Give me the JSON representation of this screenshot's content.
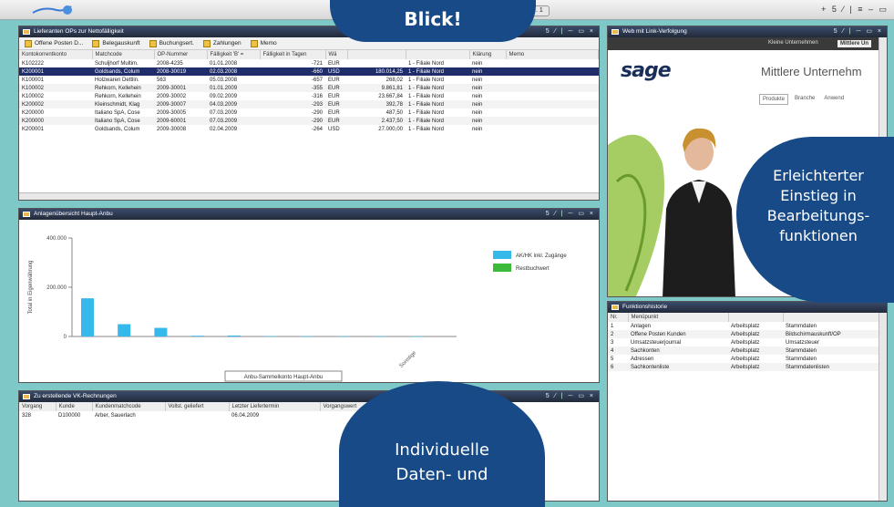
{
  "topbar": {
    "tab_label": "Liefer... 1",
    "icons": "+ 5 ⁄ | ≡ – ▭"
  },
  "payables": {
    "title": "Lieferanten OPs zur Nettofälligkeit",
    "toolbar": [
      "Offene Posten D...",
      "Belegauskunft",
      "Buchungsert.",
      "Zahlungen",
      "Memo"
    ],
    "columns": [
      "Kontokorrentkonto",
      "Matchcode",
      "OP-Nummer",
      "Fälligkeit 'B' =",
      "Fälligkeit in Tagen",
      "Wä",
      "",
      "",
      "Klärung",
      "Memo"
    ],
    "rows": [
      [
        "K102222",
        "Schuljhorf Multim.",
        "2008-4235",
        "01.01.2008",
        "-721",
        "EUR",
        "",
        "1 - Filiale Nord",
        "nein",
        ""
      ],
      [
        "K200001",
        "Goldsands, Colum",
        "2008-30019",
        "02.03.2008",
        "-660",
        "USD",
        "180.014,25",
        "1 - Filiale Nord",
        "nein",
        ""
      ],
      [
        "K100001",
        "Holzwaren Dettlin.",
        "563",
        "05.03.2008",
        "-657",
        "EUR",
        "268,02",
        "1 - Filiale Nord",
        "nein",
        ""
      ],
      [
        "K100002",
        "Rehkorn, Kellehein",
        "2009-30001",
        "01.01.2009",
        "-355",
        "EUR",
        "9.861,81",
        "1 - Filiale Nord",
        "nein",
        ""
      ],
      [
        "K100002",
        "Rehkorn, Kellehein",
        "2009-30002",
        "09.02.2009",
        "-316",
        "EUR",
        "23.667,84",
        "1 - Filiale Nord",
        "nein",
        ""
      ],
      [
        "K200002",
        "Kleinschmidt, Klag",
        "2009-30007",
        "04.03.2009",
        "-293",
        "EUR",
        "392,78",
        "1 - Filiale Nord",
        "nein",
        ""
      ],
      [
        "K200000",
        "Italiano SpA, Cose",
        "2009-30005",
        "07.03.2009",
        "-290",
        "EUR",
        "487,50",
        "1 - Filiale Nord",
        "nein",
        ""
      ],
      [
        "K200000",
        "Italiano SpA, Cose",
        "2009-60001",
        "07.03.2009",
        "-290",
        "EUR",
        "2.437,50",
        "1 - Filiale Nord",
        "nein",
        ""
      ],
      [
        "K200001",
        "Goldsands, Colum",
        "2009-30008",
        "02.04.2009",
        "-264",
        "USD",
        "27.000,00",
        "1 - Filiale Nord",
        "nein",
        ""
      ]
    ]
  },
  "assets": {
    "title": "Anlagenübersicht Haupt-Anbu",
    "legend_button": "Anbu-Sammelkonto Haupt-Anbu",
    "chart_data": {
      "type": "bar",
      "ylabel": "Total in Eigenwährung",
      "ylim": [
        0,
        400000
      ],
      "yticks": [
        "400.000",
        "200.000",
        "0"
      ],
      "categories": [
        "",
        "",
        "",
        "",
        "",
        "",
        "",
        "",
        "",
        "Sonstige"
      ],
      "series": [
        {
          "name": "AK/HK inkl. Zugänge",
          "color": "#35b8ea",
          "values": [
            155000,
            50000,
            35000,
            3000,
            4000,
            1500,
            1000,
            800,
            500,
            300
          ]
        },
        {
          "name": "Restbuchwert",
          "color": "#3cba3c",
          "values": [
            0,
            0,
            0,
            0,
            0,
            0,
            0,
            0,
            0,
            0
          ]
        }
      ]
    }
  },
  "invoices": {
    "title": "Zu erstellende VK-Rechnungen",
    "columns": [
      "Vorgang",
      "Kunde",
      "Kundenmatchcode",
      "Vollst. geliefert",
      "Letzter Liefertermin",
      "Vorgangswert"
    ],
    "rows": [
      [
        "328",
        "D100000",
        "Arber, Sauerlach",
        "",
        "06.04.2009",
        ""
      ]
    ]
  },
  "web": {
    "title": "Web mit Link-Verfolgung",
    "tabs": [
      "Kleine Unternehmen",
      "Mittlere Un"
    ],
    "logo": "sage",
    "heading": "Mittlere Unternehm",
    "nav": [
      "Produkte",
      "Branche",
      "Anwend"
    ]
  },
  "history": {
    "title": "Funktionshistorie",
    "columns": [
      "Nr.",
      "Menüpunkt",
      "",
      "",
      ""
    ],
    "rows": [
      [
        "1",
        "Anlagen",
        "Arbeitsplatz",
        "Stammdaten"
      ],
      [
        "2",
        "Offene Posten Kunden",
        "Arbeitsplatz",
        "Bildschirmauskunft/OP"
      ],
      [
        "3",
        "Umsatzsteuerjournal",
        "Arbeitsplatz",
        "Umsatzsteuer"
      ],
      [
        "4",
        "Sachkonten",
        "Arbeitsplatz",
        "Stammdaten"
      ],
      [
        "5",
        "Adressen",
        "Arbeitsplatz",
        "Stammdaten"
      ],
      [
        "6",
        "Sachkontenliste",
        "Arbeitsplatz",
        "Stammdatenlisten"
      ]
    ]
  },
  "bubbles": {
    "top": "Blick!",
    "right": [
      "Erleichterter",
      "Einstieg in",
      "Bearbeitungs-",
      "funktionen"
    ],
    "bottom": [
      "Individuelle",
      "Daten- und"
    ]
  }
}
